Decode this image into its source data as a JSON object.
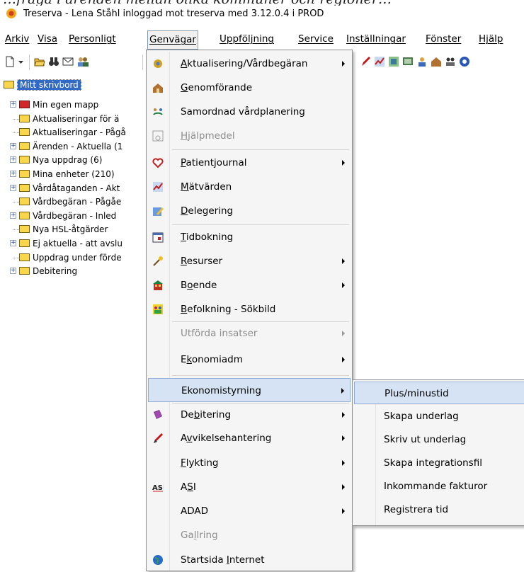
{
  "window": {
    "title": "Treserva - Lena Ståhl inloggad mot treserva  med 3.12.0.4 i PROD"
  },
  "top_caption_fragment": "…fråga i ärenden mellan olika kommuner och regioner…",
  "menubar": {
    "items": [
      "Arkiv",
      "Visa",
      "Personligt",
      "Genvägar",
      "Uppföljning",
      "Service",
      "Inställningar",
      "Fönster",
      "Hjälp"
    ]
  },
  "toolbar": {
    "icons": [
      "new-document-icon",
      "dropdown-arrow-icon",
      "open-folder-icon",
      "binoculars-icon",
      "envelope-icon",
      "users-icon"
    ]
  },
  "tree": {
    "root": "Mitt skrivbord",
    "items": [
      {
        "label": "Min egen mapp",
        "expand": true
      },
      {
        "label": "Aktualiseringar för ä",
        "expand": false
      },
      {
        "label": "Aktualiseringar - Pågå",
        "expand": false
      },
      {
        "label": "Ärenden - Aktuella (1",
        "expand": true
      },
      {
        "label": "Nya uppdrag (6)",
        "expand": true
      },
      {
        "label": "Mina enheter (210)",
        "expand": true
      },
      {
        "label": "Vårdåtaganden - Akt",
        "expand": true
      },
      {
        "label": "Vårdbegäran - Pågåe",
        "expand": false
      },
      {
        "label": "Vårdbegäran - Inled",
        "expand": true
      },
      {
        "label": "Nya HSL-åtgärder",
        "expand": false
      },
      {
        "label": "Ej aktuella - att avslu",
        "expand": true
      },
      {
        "label": "Uppdrag under förde",
        "expand": false
      },
      {
        "label": "Debitering",
        "expand": true
      }
    ]
  },
  "genvagar_menu": {
    "items": [
      {
        "label": "Aktualisering/Vårdbegäran",
        "u": "A",
        "submenu": true,
        "icon": "gear-icon"
      },
      {
        "label": "Genomförande",
        "u": "G",
        "submenu": false,
        "icon": "house-icon"
      },
      {
        "label": "Samordnad vårdplanering",
        "u": "",
        "submenu": false,
        "icon": "people-arrow-icon"
      },
      {
        "label": "Hjälpmedel",
        "u": "H",
        "submenu": false,
        "icon": "wheelchair-icon",
        "disabled": true
      },
      {
        "label": "Patientjournal",
        "u": "P",
        "submenu": true,
        "icon": "heart-icon"
      },
      {
        "label": "Mätvärden",
        "u": "M",
        "submenu": false,
        "icon": "chart-icon"
      },
      {
        "label": "Delegering",
        "u": "D",
        "submenu": false,
        "icon": "pencil-note-icon"
      },
      {
        "label": "Tidbokning",
        "u": "T",
        "submenu": false,
        "icon": "calendar-icon"
      },
      {
        "label": "Resurser",
        "u": "R",
        "submenu": true,
        "icon": "wand-icon"
      },
      {
        "label": "Boende",
        "u": "o",
        "submenu": true,
        "icon": "building-icon"
      },
      {
        "label": "Befolkning - Sökbild",
        "u": "B",
        "submenu": false,
        "icon": "population-icon"
      },
      {
        "label": "Utförda insatser",
        "u": "",
        "submenu": true,
        "icon": "",
        "disabled": true
      },
      {
        "label": "Ekonomiadm",
        "u": "k",
        "submenu": true,
        "icon": ""
      },
      {
        "label": "Ekonomistyrning",
        "u": "",
        "submenu": true,
        "icon": "",
        "highlighted": true
      },
      {
        "label": "Debitering",
        "u": "b",
        "submenu": true,
        "icon": "book-icon"
      },
      {
        "label": "Avvikelsehantering",
        "u": "v",
        "submenu": true,
        "icon": "red-pen-icon"
      },
      {
        "label": "Flykting",
        "u": "F",
        "submenu": true,
        "icon": ""
      },
      {
        "label": "ASI",
        "u": "S",
        "submenu": true,
        "icon": "asi-icon"
      },
      {
        "label": "ADAD",
        "u": "",
        "submenu": true,
        "icon": ""
      },
      {
        "label": "Gallring",
        "u": "l",
        "submenu": false,
        "icon": "",
        "disabled": true
      },
      {
        "label": "Startsida Internet",
        "u": "I",
        "submenu": false,
        "icon": "globe-icon"
      }
    ]
  },
  "ekonomistyrning_submenu": {
    "items": [
      {
        "label": "Plus/minustid",
        "highlighted": true
      },
      {
        "label": "Skapa underlag"
      },
      {
        "label": "Skriv ut underlag"
      },
      {
        "label": "Skapa integrationsfil"
      },
      {
        "label": "Inkommande fakturor"
      },
      {
        "label": "Registrera tid"
      }
    ]
  },
  "colors": {
    "selection": "#316ac5",
    "menu_highlight": "#d6e3f4",
    "menu_bg": "#f5f5f5"
  }
}
